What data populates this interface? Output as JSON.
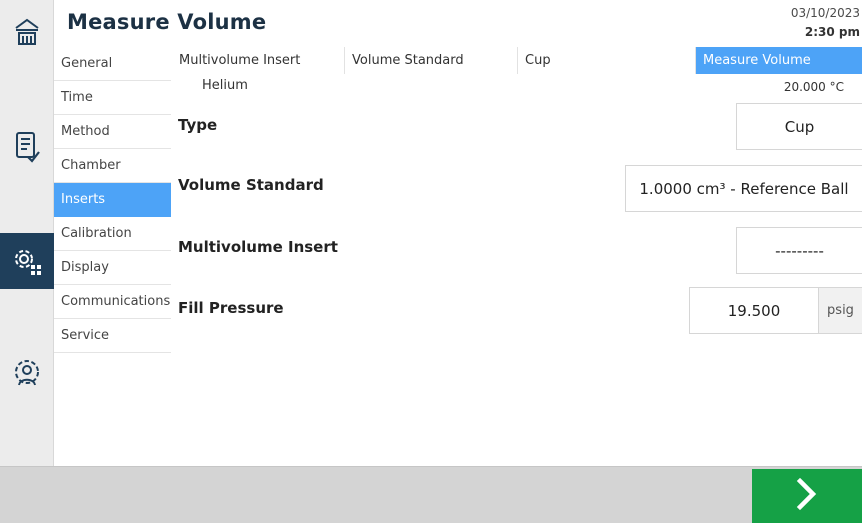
{
  "header": {
    "title": "Measure Volume",
    "date": "03/10/2023",
    "time": "2:30 pm"
  },
  "rail": {
    "icons": [
      "home-icon",
      "method-icon",
      "system-settings-icon",
      "user-settings-icon"
    ],
    "active": "system-settings-icon"
  },
  "menu": {
    "items": [
      {
        "label": "General"
      },
      {
        "label": "Time"
      },
      {
        "label": "Method"
      },
      {
        "label": "Chamber"
      },
      {
        "label": "Inserts"
      },
      {
        "label": "Calibration"
      },
      {
        "label": "Display"
      },
      {
        "label": "Communications"
      },
      {
        "label": "Service"
      }
    ],
    "active": "Inserts"
  },
  "tabs": {
    "items": [
      {
        "label": "Multivolume Insert"
      },
      {
        "label": "Volume Standard"
      },
      {
        "label": "Cup"
      },
      {
        "label": "Measure Volume"
      }
    ],
    "active": "Measure Volume"
  },
  "status": {
    "gas": "Helium",
    "temperature": "20.000 °C"
  },
  "form": {
    "type": {
      "label": "Type",
      "value": "Cup"
    },
    "volume_standard": {
      "label": "Volume Standard",
      "value": "1.0000 cm³ - Reference Ball"
    },
    "multivolume_insert": {
      "label": "Multivolume Insert",
      "value": "---------"
    },
    "fill_pressure": {
      "label": "Fill Pressure",
      "value": "19.500",
      "unit": "psig"
    }
  },
  "footer": {
    "next_icon": "chevron-right-icon"
  },
  "colors": {
    "accent": "#4da3f7",
    "rail_active": "#1f3f5b",
    "title": "#1c3144",
    "next_button": "#15a146",
    "footer": "#d4d4d4"
  }
}
